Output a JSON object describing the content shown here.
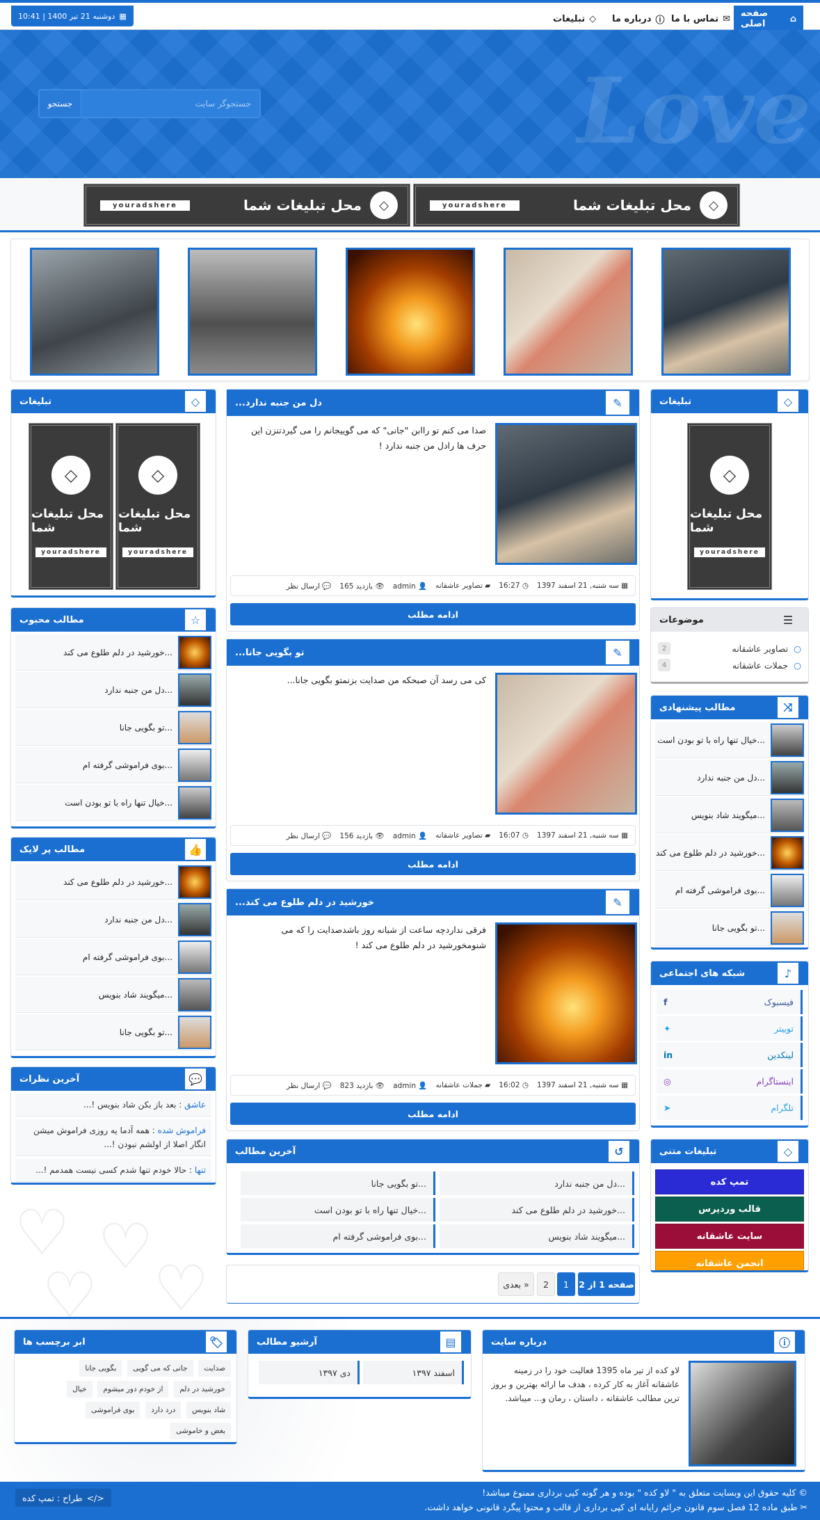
{
  "topbar": {
    "nav": [
      {
        "label": "صفحه اصلی",
        "icon": "home-icon"
      },
      {
        "label": "تماس با ما",
        "icon": "envelope-icon"
      },
      {
        "label": "درباره ما",
        "icon": "info-icon"
      },
      {
        "label": "تبلیغات",
        "icon": "diamond-icon"
      }
    ],
    "date": "دوشنبه 21 تیر 1400 | 10:41"
  },
  "header": {
    "logo_text": "Love",
    "search_placeholder": "جستجوگر سایت",
    "search_button": "جستجو"
  },
  "ad_banners": [
    {
      "title": "محل تبلیغات شما",
      "url": "youradshere"
    },
    {
      "title": "محل تبلیغات شما",
      "url": "youradshere"
    }
  ],
  "posts": [
    {
      "title": "دل من جنبه ندارد...",
      "text": "صدا می کنم تو راابن \"جانی\" که می گوییجانم را می گیردتنزن این حرف ها رادل من جنبه ندارد !",
      "date": "سه شنبه, 21 اسفند 1397",
      "time": "16:27",
      "category": "تصاویر عاشقانه",
      "author": "admin",
      "views": "165 بازدید",
      "comment": "ارسال نظر",
      "more": "ادامه مطلب"
    },
    {
      "title": "تو بگویی جانا...",
      "text": "کی می رسد آن صبحکه من صدایت بزنمتو بگویی جانا...",
      "date": "سه شنبه, 21 اسفند 1397",
      "time": "16:07",
      "category": "تصاویر عاشقانه",
      "author": "admin",
      "views": "156 بازدید",
      "comment": "ارسال نظر",
      "more": "ادامه مطلب"
    },
    {
      "title": "خورشید در دلم طلوع می کند...",
      "text": "فرقی نداردچه ساعت از شبانه روز باشدصدایت را که می شنومخورشید در دلم طلوع می کند !",
      "date": "سه شنبه, 21 اسفند 1397",
      "time": "16:02",
      "category": "جملات عاشقانه",
      "author": "admin",
      "views": "823 بازدید",
      "comment": "ارسال نظر",
      "more": "ادامه مطلب"
    }
  ],
  "right_sidebar": {
    "ads_title": "تبلیغات",
    "ad": {
      "title": "محل تبلیغات شما",
      "url": "youradshere"
    },
    "topics_title": "موضوعات",
    "topics": [
      {
        "label": "تصاویر عاشقانه",
        "count": "2"
      },
      {
        "label": "جملات عاشقانه",
        "count": "4"
      }
    ],
    "suggested_title": "مطالب پیشنهادی",
    "suggested": [
      "خیال تنها راه با تو بودن است...",
      "دل من جنبه ندارد...",
      "میگویند شاد بنویس...",
      "خورشید در دلم طلوع می کند...",
      "بوی فراموشی گرفته ام...",
      "تو بگویی جانا..."
    ],
    "social_title": "شبکه های اجتماعی",
    "social": [
      {
        "label": "فیسبوک",
        "icon": "facebook-icon",
        "color": "#3b5998"
      },
      {
        "label": "توییتر",
        "icon": "twitter-icon",
        "color": "#1da1f2"
      },
      {
        "label": "لینکدین",
        "icon": "linkedin-icon",
        "color": "#0077b5"
      },
      {
        "label": "اینستاگرام",
        "icon": "instagram-icon",
        "color": "#8a3ab9"
      },
      {
        "label": "تلگرام",
        "icon": "telegram-icon",
        "color": "#2aa3df"
      }
    ],
    "text_ads_title": "تبلیغات متنی",
    "text_ads": [
      {
        "label": "تمپ کده",
        "color": "#2b2bd6"
      },
      {
        "label": "قالب وردپرس",
        "color": "#0b5f4e"
      },
      {
        "label": "سایت عاشقانه",
        "color": "#9b0e3a"
      },
      {
        "label": "انجمن عاشقانه",
        "color": "#ffa000"
      }
    ]
  },
  "left_sidebar": {
    "ads_title": "تبلیغات",
    "ads": [
      {
        "title": "محل تبلیغات شما",
        "url": "youradshere"
      },
      {
        "title": "محل تبلیغات شما",
        "url": "youradshere"
      }
    ],
    "popular_title": "مطالب محبوب",
    "popular": [
      "خورشید در دلم طلوع می کند...",
      "دل من جنبه ندارد...",
      "تو بگویی جانا...",
      "بوی فراموشی گرفته ام...",
      "خیال تنها راه با تو بودن است..."
    ],
    "liked_title": "مطالب پر لایک",
    "liked": [
      "خورشید در دلم طلوع می کند...",
      "دل من جنبه ندارد...",
      "بوی فراموشی گرفته ام...",
      "میگویند شاد بنویس...",
      "تو بگویی جانا..."
    ],
    "comments_title": "آخرین نظرات",
    "comments": [
      {
        "name": "عاشق",
        "text": "بعد باز بکن شاد بنویس !..."
      },
      {
        "name": "فراموش شده",
        "text": "همه آدما یه روزی فراموش میشن انگار اصلا از اولشم نبودن !..."
      },
      {
        "name": "تنها",
        "text": "حالا خودم تنها شدم کسی نیست همدمم !..."
      }
    ]
  },
  "latest": {
    "title": "آخرین مطالب",
    "items": [
      "دل من جنبه ندارد...",
      "تو بگویی جانا...",
      "خورشید در دلم طلوع می کند...",
      "خیال تنها راه با تو بودن است...",
      "میگویند شاد بنویس...",
      "بوی فراموشی گرفته ام..."
    ]
  },
  "pagination": {
    "info": "صفحه 1 از 2",
    "pages": [
      "1",
      "2"
    ],
    "next": "بعدی »"
  },
  "footer_boxes": {
    "about_title": "درباره سایت",
    "about_text": "لاو کده از تیر ماه 1395 فعالیت خود را در زمینه عاشقانه آغاز به کار کرده ، هدف ما ارائه بهترین و بروز ترین مطالب عاشقانه ، داستان ، رمان و... میباشد.",
    "archive_title": "آرشیو مطالب",
    "archive": [
      "اسفند ۱۳۹۷",
      "دی ۱۳۹۷"
    ],
    "tags_title": "ابر برچسب ها",
    "tags": [
      "صدایت",
      "جانی که می گویی",
      "بگویی جانا",
      "خورشید در دلم",
      "از خودم دور میشوم",
      "خیال",
      "شاد بنویس",
      "درد دارد",
      "بوی فراموشی",
      "بغض و خاموشی"
    ]
  },
  "footer": {
    "copyright": "کلیه حقوق این وبسایت متعلق به \" لاو کده \" بوده و هر گونه کپی برداری ممنوع میباشد!",
    "law": "طبق ماده 12 فصل سوم قانون جرائم رایانه ای کپی برداری از قالب و محتوا پیگرد قانونی خواهد داشت.",
    "designer": "طراح : تمپ کده"
  }
}
